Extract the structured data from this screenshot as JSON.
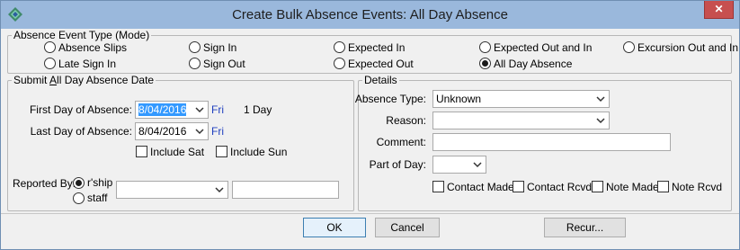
{
  "window": {
    "title": "Create Bulk Absence Events: All Day Absence",
    "close_label": "✕"
  },
  "mode_group": {
    "legend": "Absence Event Type (Mode)",
    "options": [
      {
        "label": "Absence Slips",
        "checked": false
      },
      {
        "label": "Sign In",
        "checked": false
      },
      {
        "label": "Expected In",
        "checked": false
      },
      {
        "label": "Expected Out and In",
        "checked": false
      },
      {
        "label": "Excursion Out and In",
        "checked": false
      },
      {
        "label": "Late Sign In",
        "checked": false
      },
      {
        "label": "Sign Out",
        "checked": false
      },
      {
        "label": "Expected Out",
        "checked": false
      },
      {
        "label": "All Day Absence",
        "checked": true
      }
    ]
  },
  "submit_group": {
    "legend_prefix": "Submit ",
    "legend_underlined": "A",
    "legend_suffix": "ll Day Absence Date",
    "first_day_label": "First Day of Absence:",
    "first_day_value": "8/04/2016",
    "first_day_weekday": "Fri",
    "duration": "1 Day",
    "last_day_label": "Last Day of Absence:",
    "last_day_value": "8/04/2016",
    "last_day_weekday": "Fri",
    "include_sat": "Include Sat",
    "include_sun": "Include Sun",
    "reported_by_label": "Reported By:",
    "reported_options": [
      {
        "label": "r'ship",
        "checked": true
      },
      {
        "label": "staff",
        "checked": false
      }
    ],
    "reporter_combo_value": "",
    "reporter_text_value": ""
  },
  "details_group": {
    "legend": "Details",
    "absence_type_label": "Absence Type:",
    "absence_type_value": "Unknown",
    "reason_label": "Reason:",
    "reason_value": "",
    "comment_label": "Comment:",
    "comment_value": "",
    "part_of_day_label": "Part of Day:",
    "part_of_day_value": "",
    "checks": [
      {
        "label": "Contact Made",
        "checked": false
      },
      {
        "label": "Contact Rcvd",
        "checked": false
      },
      {
        "label": "Note Made",
        "checked": false
      },
      {
        "label": "Note Rcvd",
        "checked": false
      }
    ]
  },
  "buttons": {
    "ok": "OK",
    "cancel": "Cancel",
    "recur": "Recur..."
  }
}
